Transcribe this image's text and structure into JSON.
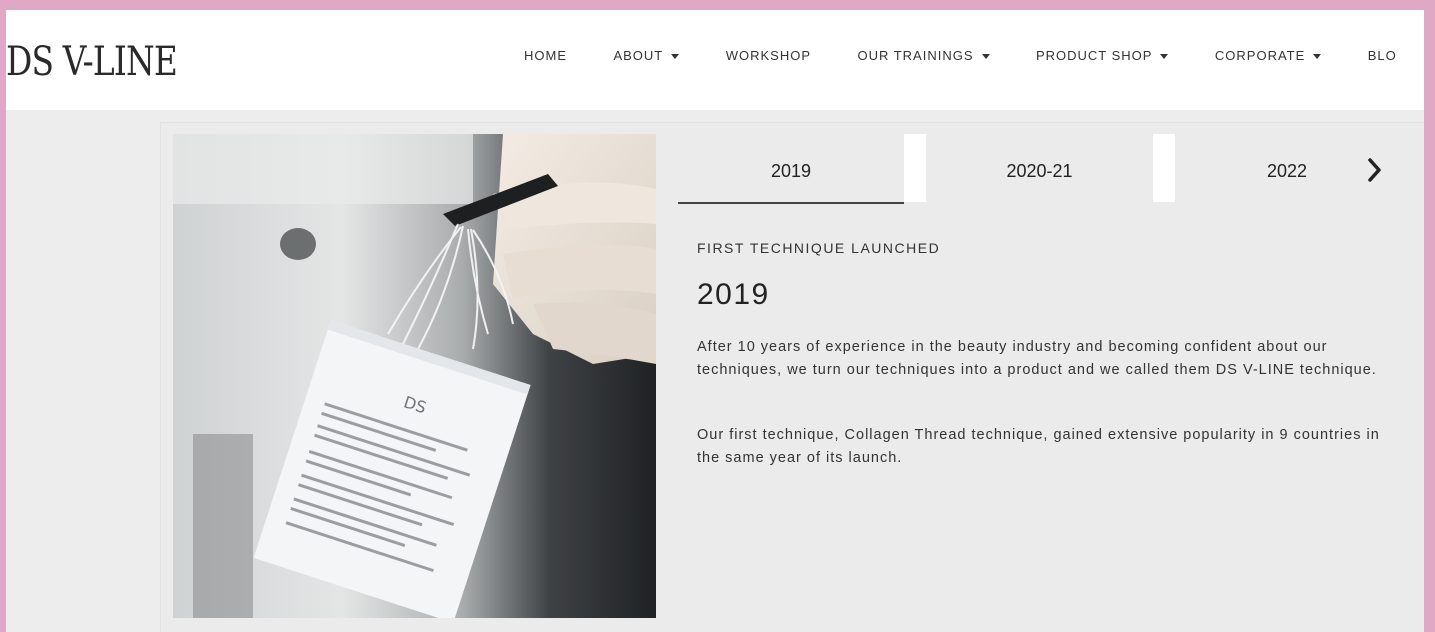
{
  "header": {
    "logo": "DS V-LINE",
    "nav": [
      {
        "label": "HOME",
        "dropdown": false
      },
      {
        "label": "ABOUT",
        "dropdown": true
      },
      {
        "label": "WORKSHOP",
        "dropdown": false
      },
      {
        "label": "OUR TRAININGS",
        "dropdown": true
      },
      {
        "label": "PRODUCT SHOP",
        "dropdown": true
      },
      {
        "label": "CORPORATE",
        "dropdown": true
      },
      {
        "label": "BLO",
        "dropdown": false
      }
    ]
  },
  "timeline": {
    "tabs": [
      {
        "label": "2019",
        "active": true
      },
      {
        "label": "2020-21",
        "active": false
      },
      {
        "label": "2022",
        "active": false
      }
    ],
    "next_icon": "chevron-right-icon",
    "eyebrow": "FIRST TECHNIQUE LAUNCHED",
    "year": "2019",
    "paragraphs": [
      "After 10 years of experience in the beauty industry and becoming confident about our techniques, we turn our techniques into a product and we called them DS V-LINE technique.",
      "Our first technique, Collagen Thread technique, gained extensive popularity in 9 countries in the same year of its launch."
    ]
  },
  "colors": {
    "frame": "#dfa9c6",
    "header_bg": "#ffffff",
    "content_bg": "#ebebeb",
    "text": "#222222"
  }
}
